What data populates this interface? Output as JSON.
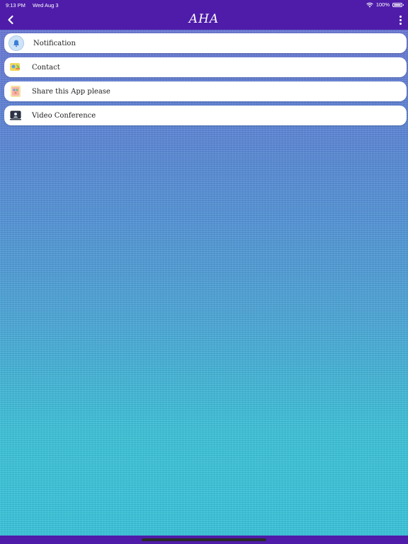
{
  "status": {
    "time": "9:13 PM",
    "date": "Wed Aug 3",
    "battery": "100%"
  },
  "nav": {
    "title": "AHA"
  },
  "menu": {
    "items": [
      {
        "label": "Notification",
        "icon": "bell-icon"
      },
      {
        "label": "Contact",
        "icon": "contact-icon"
      },
      {
        "label": "Share this App please",
        "icon": "share-icon"
      },
      {
        "label": "Video Conference",
        "icon": "video-conference-icon"
      }
    ]
  },
  "colors": {
    "header": "#4e1ca9",
    "background_top": "#6c7bd8",
    "background_bottom": "#3bc6dd"
  }
}
